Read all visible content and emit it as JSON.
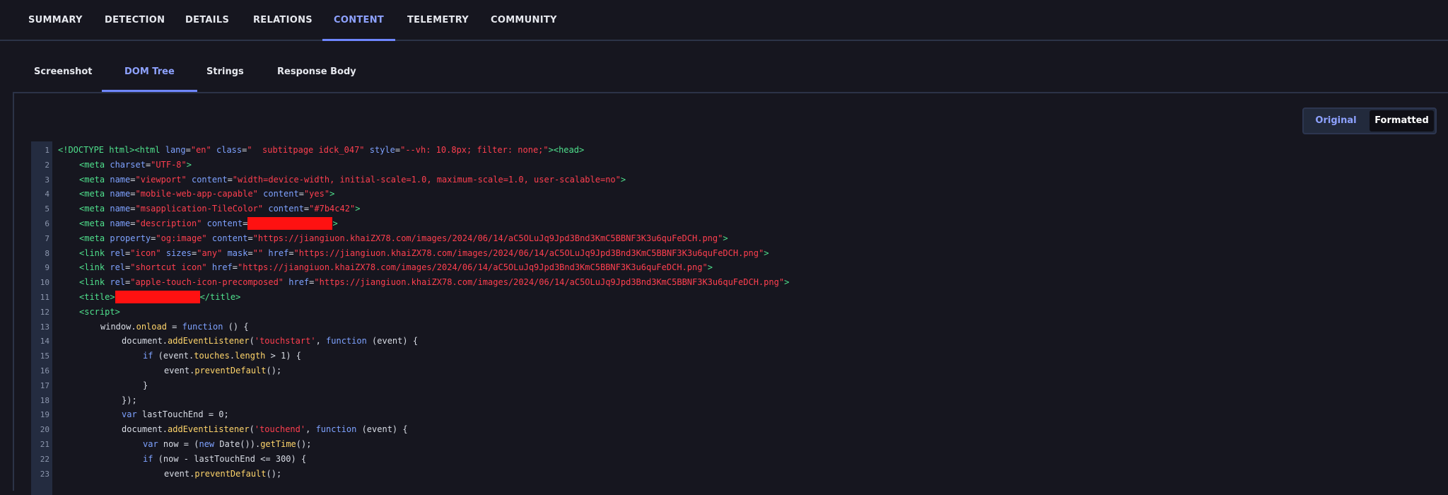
{
  "top_tabs": [
    "SUMMARY",
    "DETECTION",
    "DETAILS",
    "RELATIONS",
    "CONTENT",
    "TELEMETRY",
    "COMMUNITY"
  ],
  "top_active": "CONTENT",
  "sub_tabs": [
    "Screenshot",
    "DOM Tree",
    "Strings",
    "Response Body"
  ],
  "sub_active": "DOM Tree",
  "toggle": {
    "original": "Original",
    "formatted": "Formatted"
  },
  "code_lines": [
    {
      "n": "1",
      "indent": 0,
      "parts": [
        [
          "grn",
          "<!DOCTYPE html><html "
        ],
        [
          "blu",
          "lang"
        ],
        [
          "wht",
          "="
        ],
        [
          "red",
          "\"en\""
        ],
        [
          "wht",
          " "
        ],
        [
          "blu",
          "class"
        ],
        [
          "wht",
          "="
        ],
        [
          "red",
          "\"  subtitpage idck_047\" "
        ],
        [
          "blu",
          "style"
        ],
        [
          "wht",
          "="
        ],
        [
          "red",
          "\"--vh: 10.8px; filter: none;\""
        ],
        [
          "grn",
          "><head>"
        ]
      ]
    },
    {
      "n": "2",
      "indent": 1,
      "parts": [
        [
          "grn",
          "<meta "
        ],
        [
          "blu",
          "charset"
        ],
        [
          "wht",
          "="
        ],
        [
          "red",
          "\"UTF-8\""
        ],
        [
          "grn",
          ">"
        ]
      ]
    },
    {
      "n": "3",
      "indent": 1,
      "parts": [
        [
          "grn",
          "<meta "
        ],
        [
          "blu",
          "name"
        ],
        [
          "wht",
          "="
        ],
        [
          "red",
          "\"viewport\" "
        ],
        [
          "blu",
          "content"
        ],
        [
          "wht",
          "="
        ],
        [
          "red",
          "\"width=device-width, initial-scale=1.0, maximum-scale=1.0, user-scalable=no\""
        ],
        [
          "grn",
          ">"
        ]
      ]
    },
    {
      "n": "4",
      "indent": 1,
      "parts": [
        [
          "grn",
          "<meta "
        ],
        [
          "blu",
          "name"
        ],
        [
          "wht",
          "="
        ],
        [
          "red",
          "\"mobile-web-app-capable\" "
        ],
        [
          "blu",
          "content"
        ],
        [
          "wht",
          "="
        ],
        [
          "red",
          "\"yes\""
        ],
        [
          "grn",
          ">"
        ]
      ]
    },
    {
      "n": "5",
      "indent": 1,
      "parts": [
        [
          "grn",
          "<meta "
        ],
        [
          "blu",
          "name"
        ],
        [
          "wht",
          "="
        ],
        [
          "red",
          "\"msapplication-TileColor\" "
        ],
        [
          "blu",
          "content"
        ],
        [
          "wht",
          "="
        ],
        [
          "red",
          "\"#7b4c42\""
        ],
        [
          "grn",
          ">"
        ]
      ]
    },
    {
      "n": "6",
      "indent": 1,
      "parts": [
        [
          "grn",
          "<meta "
        ],
        [
          "blu",
          "name"
        ],
        [
          "wht",
          "="
        ],
        [
          "red",
          "\"description\" "
        ],
        [
          "blu",
          "content"
        ],
        [
          "wht",
          "="
        ],
        [
          "redact",
          "120"
        ],
        [
          "grn",
          ">"
        ]
      ]
    },
    {
      "n": "7",
      "indent": 1,
      "parts": [
        [
          "grn",
          "<meta "
        ],
        [
          "blu",
          "property"
        ],
        [
          "wht",
          "="
        ],
        [
          "red",
          "\"og:image\" "
        ],
        [
          "blu",
          "content"
        ],
        [
          "wht",
          "="
        ],
        [
          "red",
          "\"https://jiangiuon.khaiZX78.com/images/2024/06/14/aC5OLuJq9Jpd3Bnd3KmC5BBNF3K3u6quFeDCH.png\""
        ],
        [
          "grn",
          ">"
        ]
      ]
    },
    {
      "n": "8",
      "indent": 1,
      "parts": [
        [
          "grn",
          "<link "
        ],
        [
          "blu",
          "rel"
        ],
        [
          "wht",
          "="
        ],
        [
          "red",
          "\"icon\" "
        ],
        [
          "blu",
          "sizes"
        ],
        [
          "wht",
          "="
        ],
        [
          "red",
          "\"any\" "
        ],
        [
          "blu",
          "mask"
        ],
        [
          "wht",
          "="
        ],
        [
          "red",
          "\"\" "
        ],
        [
          "blu",
          "href"
        ],
        [
          "wht",
          "="
        ],
        [
          "red",
          "\"https://jiangiuon.khaiZX78.com/images/2024/06/14/aC5OLuJq9Jpd3Bnd3KmC5BBNF3K3u6quFeDCH.png\""
        ],
        [
          "grn",
          ">"
        ]
      ]
    },
    {
      "n": "9",
      "indent": 1,
      "parts": [
        [
          "grn",
          "<link "
        ],
        [
          "blu",
          "rel"
        ],
        [
          "wht",
          "="
        ],
        [
          "red",
          "\"shortcut icon\" "
        ],
        [
          "blu",
          "href"
        ],
        [
          "wht",
          "="
        ],
        [
          "red",
          "\"https://jiangiuon.khaiZX78.com/images/2024/06/14/aC5OLuJq9Jpd3Bnd3KmC5BBNF3K3u6quFeDCH.png\""
        ],
        [
          "grn",
          ">"
        ]
      ]
    },
    {
      "n": "10",
      "indent": 1,
      "parts": [
        [
          "grn",
          "<link "
        ],
        [
          "blu",
          "rel"
        ],
        [
          "wht",
          "="
        ],
        [
          "red",
          "\"apple-touch-icon-precomposed\" "
        ],
        [
          "blu",
          "href"
        ],
        [
          "wht",
          "="
        ],
        [
          "red",
          "\"https://jiangiuon.khaiZX78.com/images/2024/06/14/aC5OLuJq9Jpd3Bnd3KmC5BBNF3K3u6quFeDCH.png\""
        ],
        [
          "grn",
          ">"
        ]
      ]
    },
    {
      "n": "11",
      "indent": 1,
      "parts": [
        [
          "grn",
          "<title>"
        ],
        [
          "redact",
          "120"
        ],
        [
          "grn",
          "</title>"
        ]
      ]
    },
    {
      "n": "12",
      "indent": 1,
      "parts": [
        [
          "grn",
          "<script>"
        ]
      ]
    },
    {
      "n": "13",
      "indent": 2,
      "parts": [
        [
          "wht",
          "window"
        ],
        [
          "wht",
          "."
        ],
        [
          "ylw",
          "onload"
        ],
        [
          "wht",
          " = "
        ],
        [
          "blu",
          "function"
        ],
        [
          "wht",
          " () {"
        ]
      ]
    },
    {
      "n": "14",
      "indent": 3,
      "parts": [
        [
          "wht",
          "document."
        ],
        [
          "ylw",
          "addEventListener"
        ],
        [
          "wht",
          "("
        ],
        [
          "red",
          "'touchstart'"
        ],
        [
          "wht",
          ", "
        ],
        [
          "blu",
          "function"
        ],
        [
          "wht",
          " (event) {"
        ]
      ]
    },
    {
      "n": "15",
      "indent": 4,
      "parts": [
        [
          "blu",
          "if"
        ],
        [
          "wht",
          " (event."
        ],
        [
          "ylw",
          "touches"
        ],
        [
          "wht",
          "."
        ],
        [
          "ylw",
          "length"
        ],
        [
          "wht",
          " > 1) {"
        ]
      ]
    },
    {
      "n": "16",
      "indent": 5,
      "parts": [
        [
          "wht",
          "event."
        ],
        [
          "ylw",
          "preventDefault"
        ],
        [
          "wht",
          "();"
        ]
      ]
    },
    {
      "n": "17",
      "indent": 4,
      "parts": [
        [
          "wht",
          "}"
        ]
      ]
    },
    {
      "n": "18",
      "indent": 3,
      "parts": [
        [
          "wht",
          "});"
        ]
      ]
    },
    {
      "n": "19",
      "indent": 3,
      "parts": [
        [
          "blu",
          "var"
        ],
        [
          "wht",
          " lastTouchEnd = 0;"
        ]
      ]
    },
    {
      "n": "20",
      "indent": 3,
      "parts": [
        [
          "wht",
          "document."
        ],
        [
          "ylw",
          "addEventListener"
        ],
        [
          "wht",
          "("
        ],
        [
          "red",
          "'touchend'"
        ],
        [
          "wht",
          ", "
        ],
        [
          "blu",
          "function"
        ],
        [
          "wht",
          " (event) {"
        ]
      ]
    },
    {
      "n": "21",
      "indent": 4,
      "parts": [
        [
          "blu",
          "var"
        ],
        [
          "wht",
          " now = ("
        ],
        [
          "blu",
          "new"
        ],
        [
          "wht",
          " Date())."
        ],
        [
          "ylw",
          "getTime"
        ],
        [
          "wht",
          "();"
        ]
      ]
    },
    {
      "n": "22",
      "indent": 4,
      "parts": [
        [
          "blu",
          "if"
        ],
        [
          "wht",
          " (now - lastTouchEnd <= 300) {"
        ]
      ]
    },
    {
      "n": "23",
      "indent": 5,
      "parts": [
        [
          "wht",
          "event."
        ],
        [
          "ylw",
          "preventDefault"
        ],
        [
          "wht",
          "();"
        ]
      ]
    }
  ]
}
